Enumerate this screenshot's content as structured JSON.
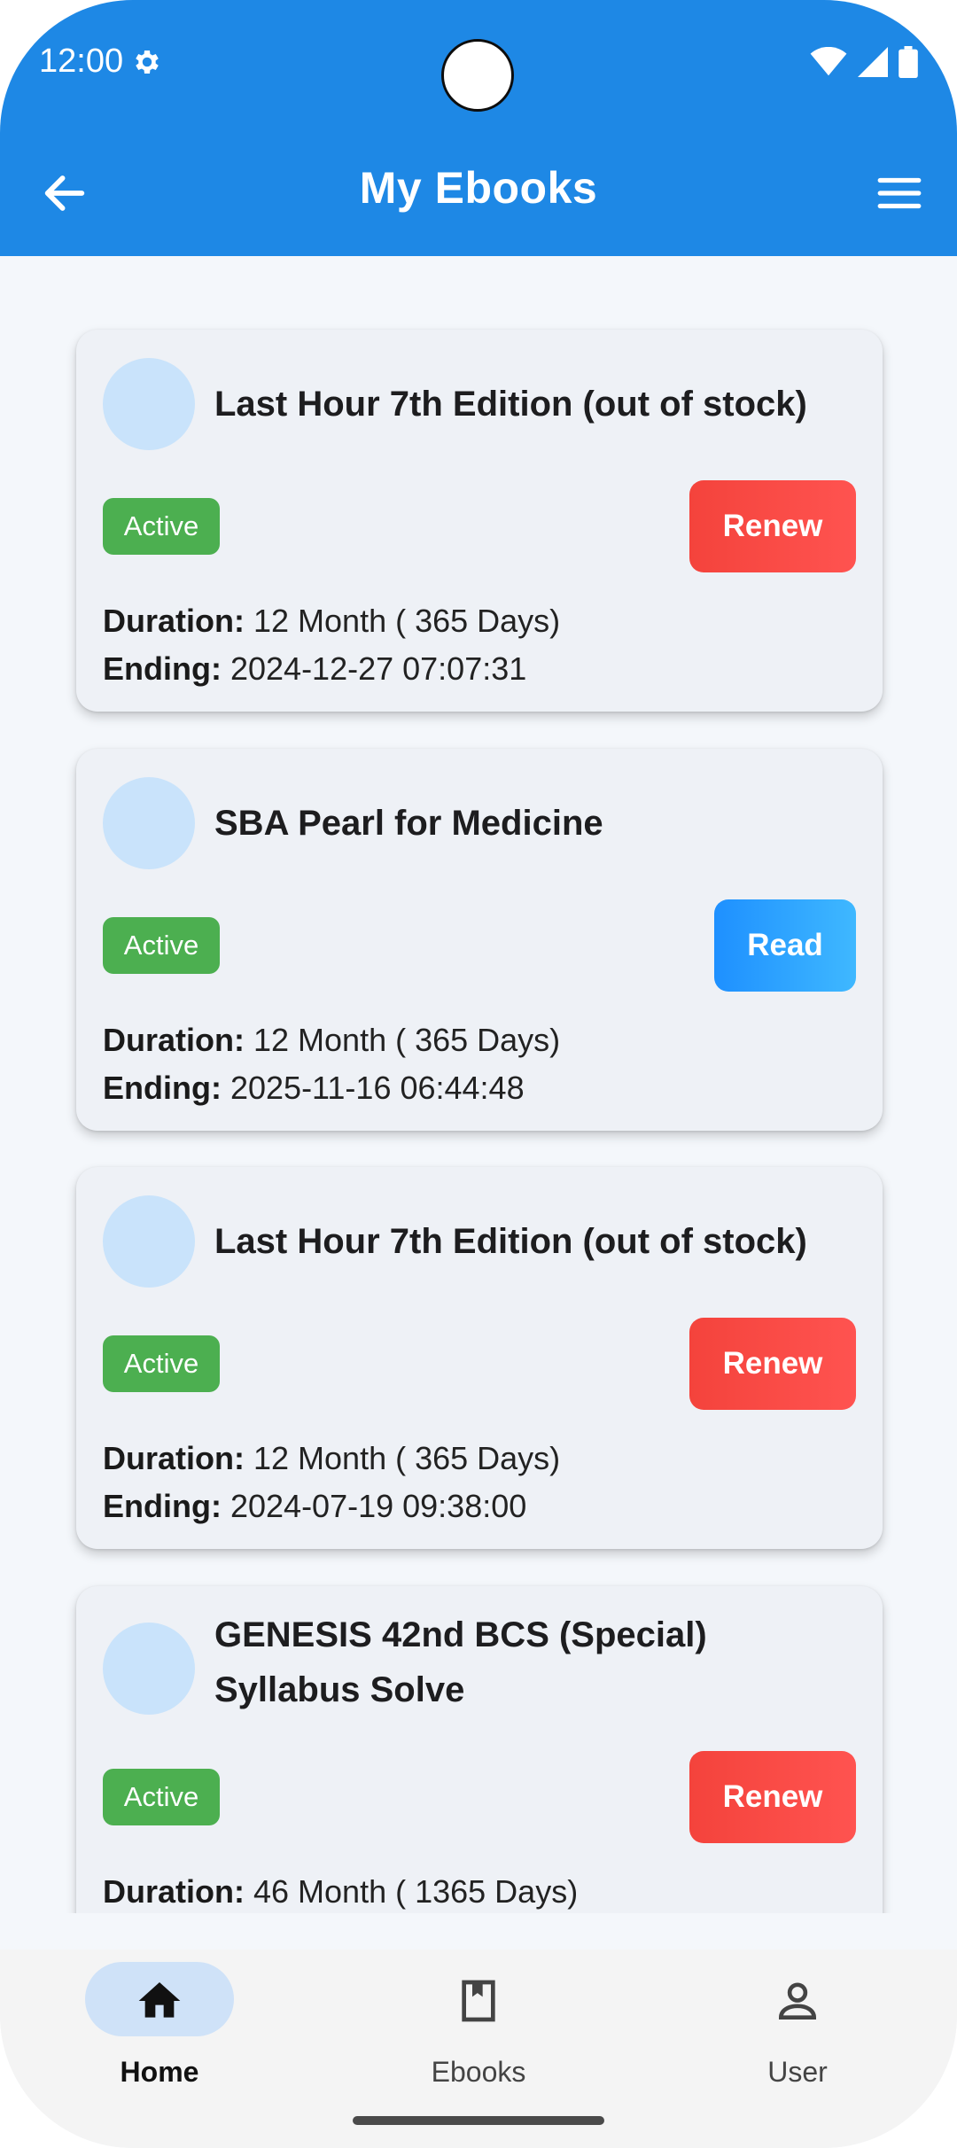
{
  "status": {
    "time": "12:00"
  },
  "appbar": {
    "title": "My Ebooks"
  },
  "labels": {
    "duration": "Duration:",
    "ending": "Ending:"
  },
  "ebooks": [
    {
      "title": "Last Hour 7th Edition (out of stock)",
      "status": "Active",
      "action": "Renew",
      "duration": "12 Month ( 365  Days)",
      "ending": "2024-12-27 07:07:31"
    },
    {
      "title": "SBA Pearl for Medicine",
      "status": "Active",
      "action": "Read",
      "duration": "12 Month ( 365  Days)",
      "ending": "2025-11-16 06:44:48"
    },
    {
      "title": "Last Hour 7th Edition (out of stock)",
      "status": "Active",
      "action": "Renew",
      "duration": "12 Month ( 365  Days)",
      "ending": "2024-07-19 09:38:00"
    },
    {
      "title": "GENESIS 42nd BCS (Special) Syllabus Solve",
      "status": "Active",
      "action": "Renew",
      "duration": "46 Month ( 1365  Days)"
    }
  ],
  "nav": [
    {
      "label": "Home",
      "icon": "home-icon",
      "active": true
    },
    {
      "label": "Ebooks",
      "icon": "book-icon",
      "active": false
    },
    {
      "label": "User",
      "icon": "user-icon",
      "active": false
    }
  ],
  "colors": {
    "primary": "#1e88e5",
    "active_badge": "#4caf50",
    "renew": "#f4433c",
    "read": "#1e90ff"
  }
}
